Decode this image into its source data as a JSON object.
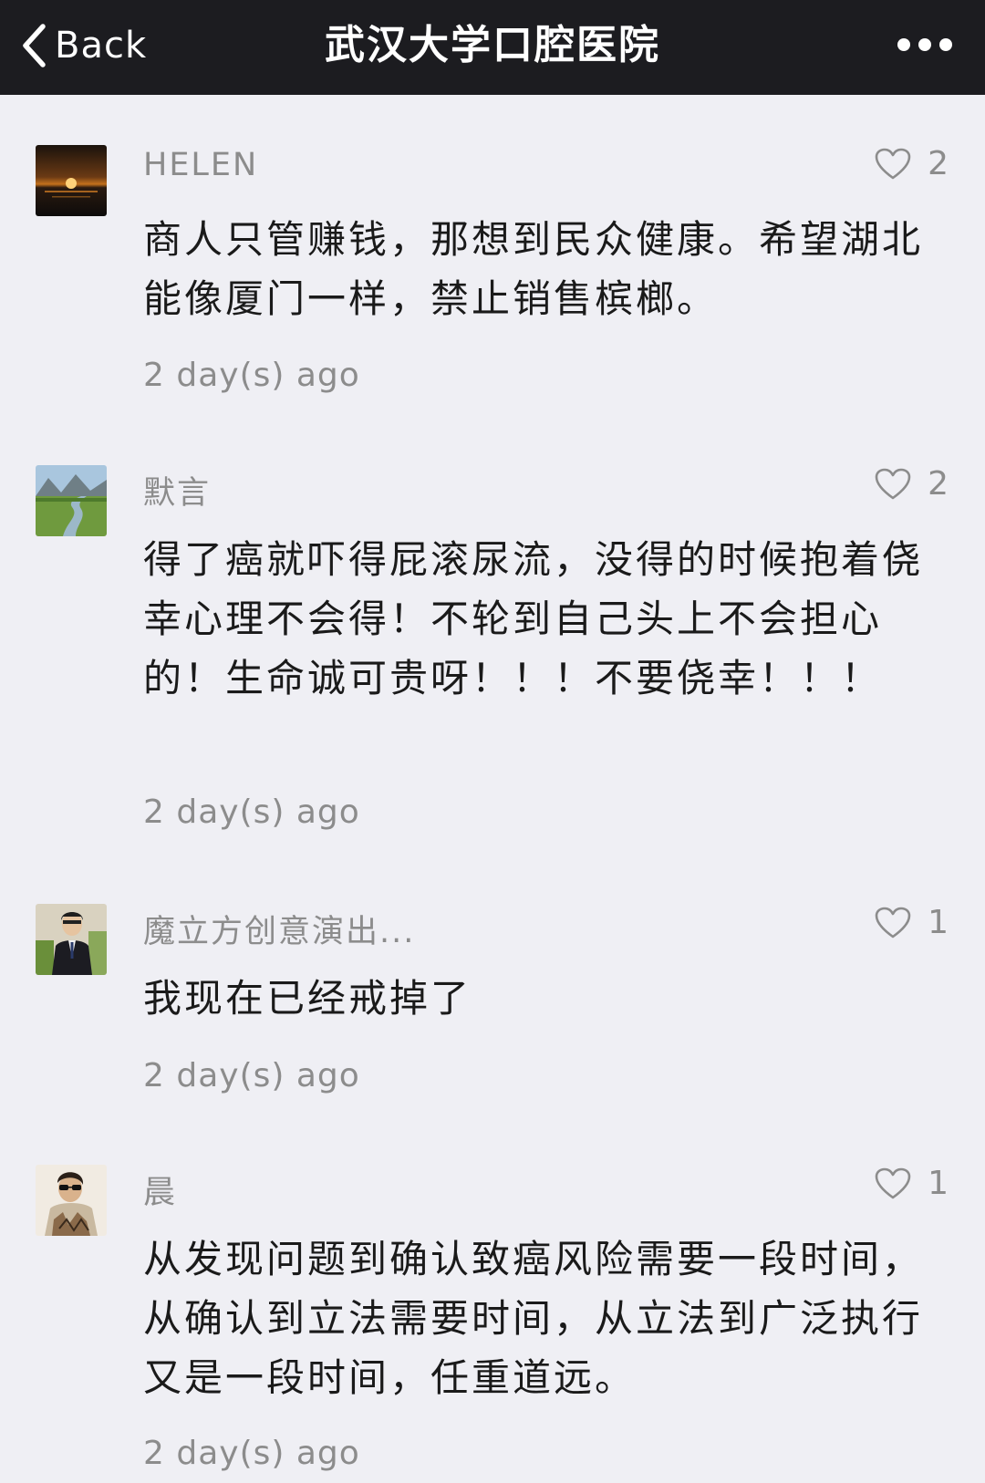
{
  "nav": {
    "back_label": "Back",
    "title": "武汉大学口腔医院"
  },
  "comments": [
    {
      "name": "HELEN",
      "likes": "2",
      "text": "商人只管赚钱，那想到民众健康。希望湖北能像厦门一样，禁止销售槟榔。",
      "time": "2 day(s) ago"
    },
    {
      "name": "默言",
      "likes": "2",
      "text": "得了癌就吓得屁滚尿流，没得的时候抱着侥幸心理不会得！不轮到自己头上不会担心的！生命诚可贵呀！！！不要侥幸！！！",
      "time": "2 day(s) ago"
    },
    {
      "name": "魔立方创意演出...",
      "likes": "1",
      "text": "我现在已经戒掉了",
      "time": "2 day(s) ago"
    },
    {
      "name": "晨",
      "likes": "1",
      "text": "从发现问题到确认致癌风险需要一段时间，从确认到立法需要时间，从立法到广泛执行又是一段时间，任重道远。",
      "time": "2 day(s) ago"
    }
  ],
  "colors": {
    "nav_bg": "#1c1c20",
    "page_bg": "#efeff4",
    "meta_text": "#8c8c8c",
    "body_text": "#1a1a1a"
  },
  "icons": {
    "back": "chevron-left-icon",
    "more": "more-dots-icon",
    "like": "heart-outline-icon"
  }
}
